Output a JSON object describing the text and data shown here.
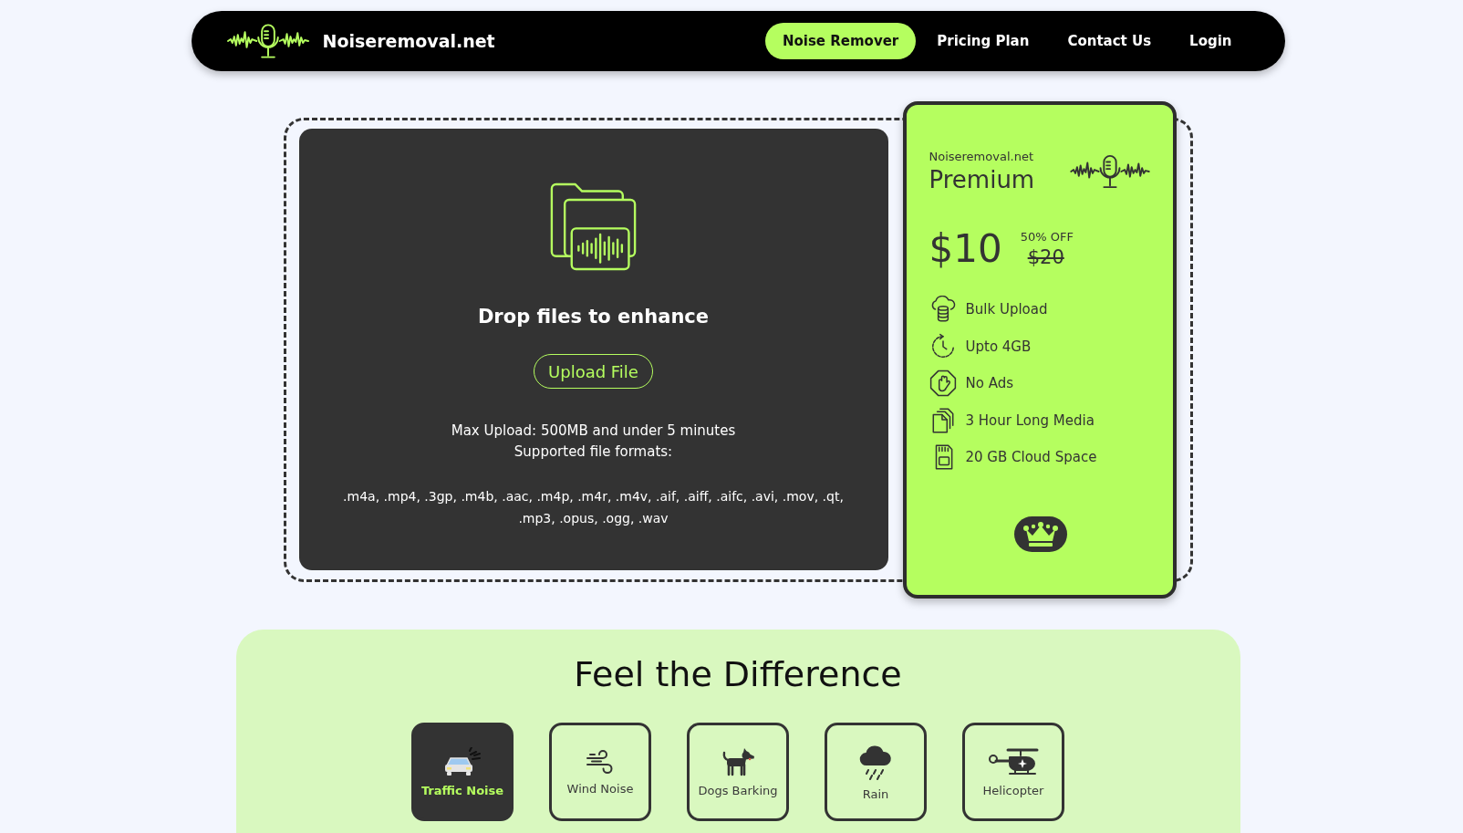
{
  "navbar": {
    "brand": "Noiseremoval.net",
    "links": [
      {
        "label": "Noise Remover",
        "selected": true
      },
      {
        "label": "Pricing Plan",
        "selected": false
      },
      {
        "label": "Contact Us",
        "selected": false
      },
      {
        "label": "Login",
        "selected": false
      }
    ]
  },
  "upload": {
    "title": "Drop files to enhance",
    "button": "Upload File",
    "limit": "Max Upload: 500MB and under 5 minutes",
    "formats_label": "Supported file formats:",
    "formats": ".m4a, .mp4, .3gp, .m4b, .aac, .m4p, .m4r, .m4v, .aif, .aiff, .aifc, .avi, .mov, .qt, .mp3, .opus, .ogg, .wav"
  },
  "premium": {
    "site": "Noiseremoval.net",
    "plan": "Premium",
    "price": "$10",
    "discount": "50% OFF",
    "old_price": "$20",
    "features": [
      {
        "kind": "cloud",
        "label": "Bulk Upload"
      },
      {
        "kind": "timer",
        "label": "Upto 4GB"
      },
      {
        "kind": "stop",
        "label": "No Ads"
      },
      {
        "kind": "files",
        "label": "3 Hour Long Media"
      },
      {
        "kind": "card",
        "label": "20 GB Cloud Space"
      }
    ]
  },
  "difference": {
    "title": "Feel the Difference",
    "samples": [
      {
        "kind": "traffic",
        "label": "Traffic Noise",
        "selected": true
      },
      {
        "kind": "wind",
        "label": "Wind Noise",
        "selected": false
      },
      {
        "kind": "dog",
        "label": "Dogs Barking",
        "selected": false
      },
      {
        "kind": "rain",
        "label": "Rain",
        "selected": false
      },
      {
        "kind": "helicopter",
        "label": "Helicopter",
        "selected": false
      }
    ]
  }
}
